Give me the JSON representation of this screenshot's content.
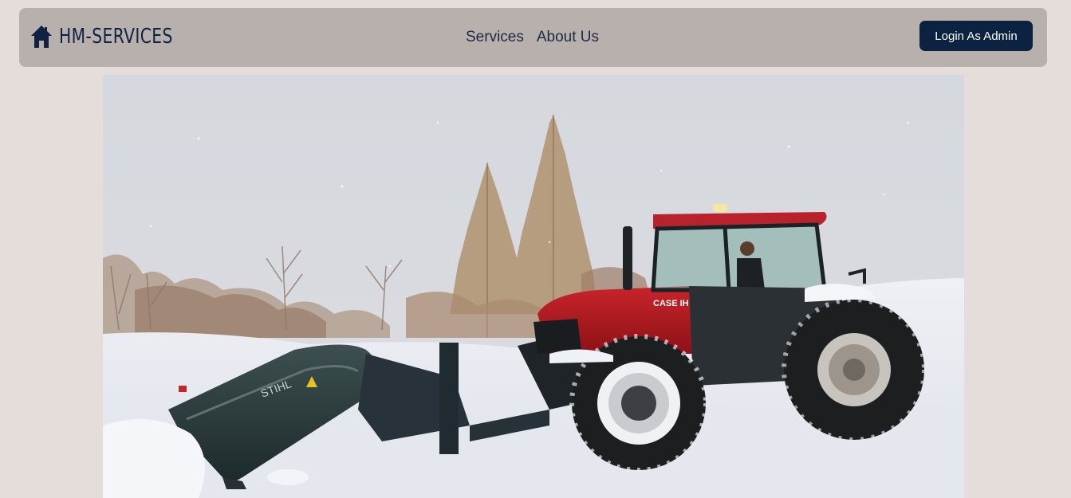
{
  "header": {
    "brand_name": "HM-SERVICES",
    "brand_icon": "house-icon",
    "nav": [
      {
        "label": "Services"
      },
      {
        "label": "About Us"
      }
    ],
    "admin_button_label": "Login As Admin"
  },
  "colors": {
    "page_background": "#e5ddd9",
    "navbar_background": "#b8b0ac",
    "brand_text": "#0f2240",
    "admin_button": "#0b2341"
  },
  "hero": {
    "image": "snow-plow-tractor-photo"
  }
}
